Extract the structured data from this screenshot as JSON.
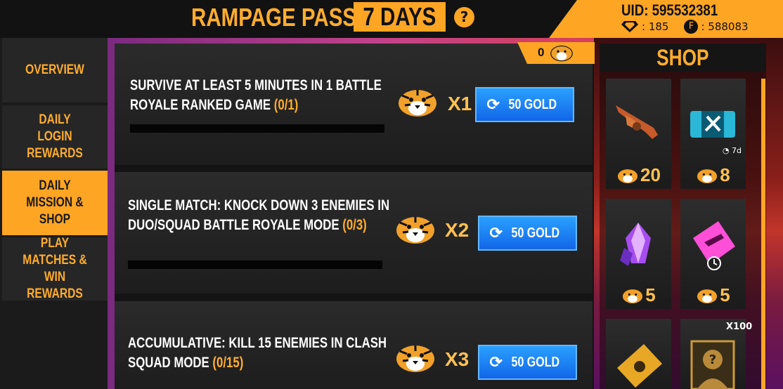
{
  "header": {
    "title": "RAMPAGE PASS",
    "days_badge": "7 DAYS",
    "help": "?",
    "uid": "UID: 595532381",
    "diamonds": ": 185",
    "coins": ": 588083"
  },
  "nav": {
    "items": [
      {
        "label": "OVERVIEW"
      },
      {
        "label": "DAILY LOGIN REWARDS"
      },
      {
        "label": "DAILY MISSION & SHOP"
      },
      {
        "label": "PLAY MATCHES & WIN REWARDS"
      }
    ]
  },
  "token_counter": "0",
  "missions": [
    {
      "line1": "SURVIVE AT LEAST 5 MINUTES IN 1 BATTLE",
      "line2": "ROYALE RANKED GAME",
      "progress": "(0/1)",
      "reward": "x1",
      "button": "50 GOLD"
    },
    {
      "line1": "SINGLE MATCH: KNOCK DOWN 3 ENEMIES IN",
      "line2": "DUO/SQUAD BATTLE ROYALE MODE",
      "progress": "(0/3)",
      "reward": "x2",
      "button": "50 GOLD"
    },
    {
      "line1": "ACCUMULATIVE: KILL 15 ENEMIES IN CLASH",
      "line2": "SQUAD MODE",
      "progress": "(0/15)",
      "reward": "x3",
      "button": "50 GOLD"
    }
  ],
  "shop": {
    "title": "SHOP",
    "items": [
      {
        "icon": "tommy-gun-icon",
        "price": "20"
      },
      {
        "icon": "weapon-crate-ticket-icon",
        "price": "8",
        "tag": "7d"
      },
      {
        "icon": "purple-crystal-icon",
        "price": "5"
      },
      {
        "icon": "pink-gun-ticket-icon",
        "price": "5"
      },
      {
        "icon": "gold-voucher-icon",
        "price": ""
      },
      {
        "icon": "mystery-character-icon",
        "price": "",
        "tag": "X100"
      }
    ]
  },
  "colors": {
    "accent": "#ffa524",
    "button_blue": "#1a7df0",
    "bg": "#141414"
  }
}
